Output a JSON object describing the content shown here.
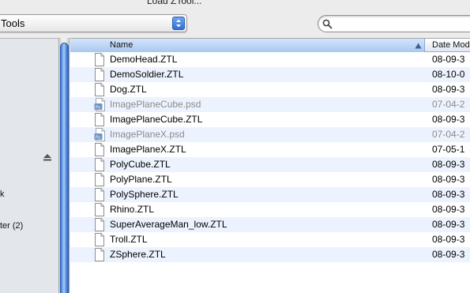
{
  "window": {
    "title": "Load ZTool..."
  },
  "location_popup": {
    "label": "Tools"
  },
  "search": {
    "value": ""
  },
  "sidebar": {
    "items": [
      {
        "label": "k"
      },
      {
        "label": "ter (2)"
      }
    ]
  },
  "file_list": {
    "columns": {
      "name": "Name",
      "date": "Date Mod"
    },
    "rows": [
      {
        "name": "DemoHead.ZTL",
        "date": "08-09-3",
        "icon": "ztl-document-icon",
        "enabled": true
      },
      {
        "name": "DemoSoldier.ZTL",
        "date": "08-10-0",
        "icon": "ztl-document-icon",
        "enabled": true
      },
      {
        "name": "Dog.ZTL",
        "date": "08-09-3",
        "icon": "ztl-document-icon",
        "enabled": true
      },
      {
        "name": "ImagePlaneCube.psd",
        "date": "07-04-2",
        "icon": "psd-document-icon",
        "enabled": false
      },
      {
        "name": "ImagePlaneCube.ZTL",
        "date": "08-09-3",
        "icon": "ztl-document-icon",
        "enabled": true
      },
      {
        "name": "ImagePlaneX.psd",
        "date": "07-04-2",
        "icon": "psd-document-icon",
        "enabled": false
      },
      {
        "name": "ImagePlaneX.ZTL",
        "date": "07-05-1",
        "icon": "ztl-document-icon",
        "enabled": true
      },
      {
        "name": "PolyCube.ZTL",
        "date": "08-09-3",
        "icon": "ztl-document-icon",
        "enabled": true
      },
      {
        "name": "PolyPlane.ZTL",
        "date": "08-09-3",
        "icon": "ztl-document-icon",
        "enabled": true
      },
      {
        "name": "PolySphere.ZTL",
        "date": "08-09-3",
        "icon": "ztl-document-icon",
        "enabled": true
      },
      {
        "name": "Rhino.ZTL",
        "date": "08-09-3",
        "icon": "ztl-document-icon",
        "enabled": true
      },
      {
        "name": "SuperAverageMan_low.ZTL",
        "date": "08-09-3",
        "icon": "ztl-document-icon",
        "enabled": true
      },
      {
        "name": "Troll.ZTL",
        "date": "08-09-3",
        "icon": "ztl-document-icon",
        "enabled": true
      },
      {
        "name": "ZSphere.ZTL",
        "date": "08-09-3",
        "icon": "ztl-document-icon",
        "enabled": true
      }
    ]
  },
  "colors": {
    "selection_accent": "#3b78d8",
    "row_alternate": "#edf3fe",
    "disabled_text": "#8a8a8a"
  }
}
